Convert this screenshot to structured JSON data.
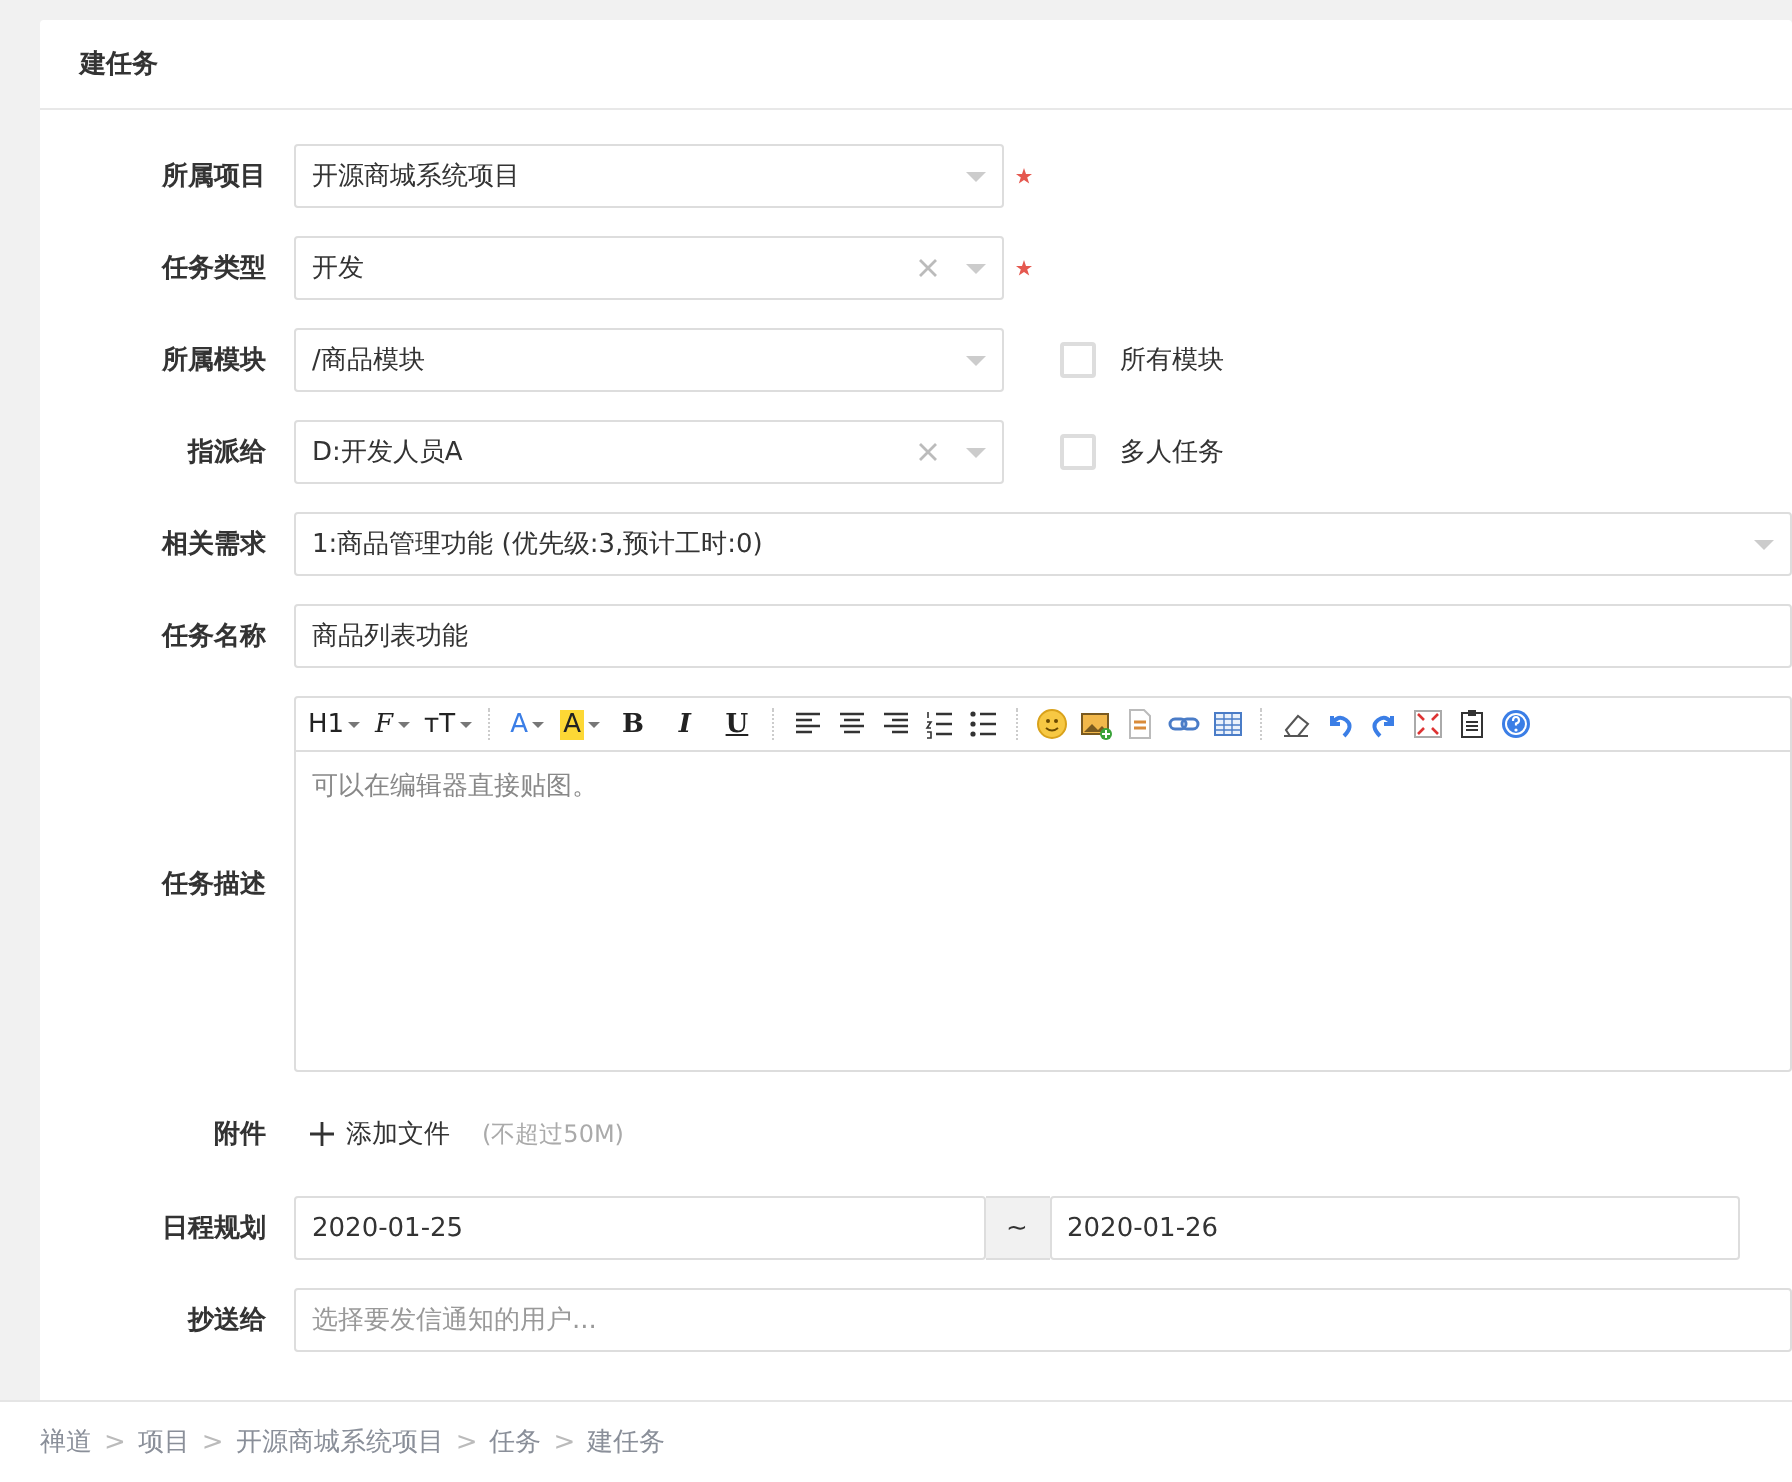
{
  "header": {
    "title": "建任务"
  },
  "fields": [
    {
      "kind": "select",
      "label": "所属项目",
      "value": "开源商城系统项目",
      "clearable": false,
      "required": true
    },
    {
      "kind": "select",
      "label": "任务类型",
      "value": "开发",
      "clearable": true,
      "required": true
    },
    {
      "kind": "select",
      "label": "所属模块",
      "value": "/商品模块",
      "clearable": false,
      "required": false,
      "checkbox": {
        "label": "所有模块",
        "checked": false
      }
    },
    {
      "kind": "select",
      "label": "指派给",
      "value": "D:开发人员A",
      "clearable": true,
      "required": false,
      "checkbox": {
        "label": "多人任务",
        "checked": false
      }
    },
    {
      "kind": "wide-select",
      "label": "相关需求",
      "value": "1:商品管理功能 (优先级:3,预计工时:0)"
    },
    {
      "kind": "text",
      "label": "任务名称",
      "value": "商品列表功能"
    },
    {
      "kind": "editor",
      "label": "任务描述",
      "placeholder": "可以在编辑器直接贴图。",
      "toolbar": [
        {
          "kind": "dropdown",
          "label": "H1"
        },
        {
          "kind": "dropdown",
          "label": "F"
        },
        {
          "kind": "dropdown",
          "label": "ᴛT"
        },
        {
          "kind": "divider"
        },
        {
          "kind": "dropdown",
          "label": "A"
        },
        {
          "kind": "dropdown",
          "label": "A"
        },
        {
          "kind": "text",
          "label": "B"
        },
        {
          "kind": "text",
          "label": "I"
        },
        {
          "kind": "text",
          "label": "U"
        },
        {
          "kind": "divider"
        },
        {
          "kind": "icon"
        },
        {
          "kind": "icon"
        },
        {
          "kind": "icon"
        },
        {
          "kind": "icon"
        },
        {
          "kind": "icon"
        },
        {
          "kind": "divider"
        },
        {
          "kind": "icon"
        },
        {
          "kind": "icon"
        },
        {
          "kind": "icon"
        },
        {
          "kind": "icon"
        },
        {
          "kind": "icon"
        },
        {
          "kind": "divider"
        },
        {
          "kind": "icon"
        },
        {
          "kind": "icon"
        },
        {
          "kind": "icon"
        },
        {
          "kind": "icon"
        },
        {
          "kind": "icon"
        },
        {
          "kind": "icon"
        }
      ]
    },
    {
      "kind": "files",
      "label": "附件",
      "action": "添加文件",
      "hint": "(不超过50M)"
    },
    {
      "kind": "daterange",
      "label": "日程规划",
      "start": "2020-01-25",
      "separator": "~",
      "end": "2020-01-26"
    },
    {
      "kind": "picker",
      "label": "抄送给",
      "placeholder": "选择要发信通知的用户..."
    }
  ],
  "breadcrumb": [
    {
      "kind": "link",
      "text": "禅道"
    },
    {
      "kind": "sep",
      "text": ">"
    },
    {
      "kind": "link",
      "text": "项目"
    },
    {
      "kind": "sep",
      "text": ">"
    },
    {
      "kind": "link",
      "text": "开源商城系统项目"
    },
    {
      "kind": "sep",
      "text": ">"
    },
    {
      "kind": "link",
      "text": "任务"
    },
    {
      "kind": "sep",
      "text": ">"
    },
    {
      "kind": "current",
      "text": "建任务"
    }
  ]
}
